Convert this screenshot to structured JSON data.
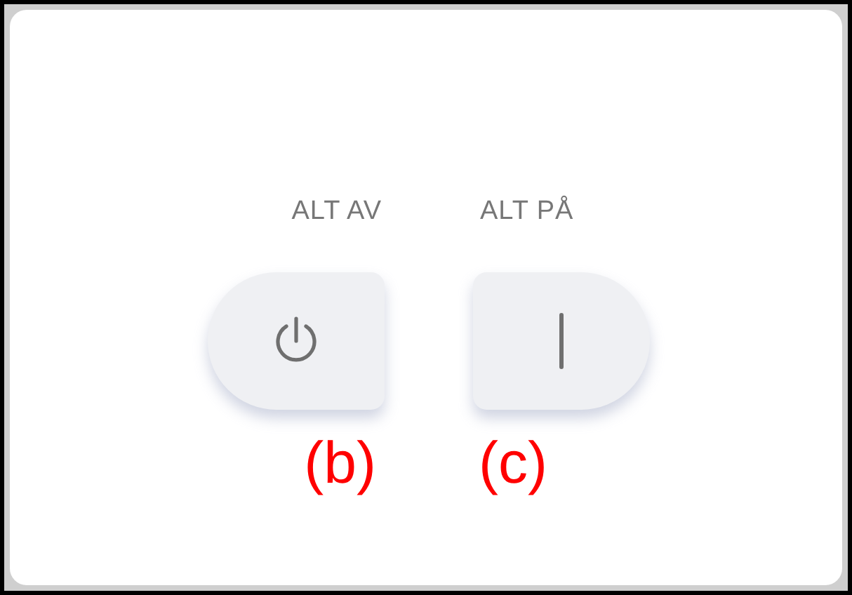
{
  "switches": [
    {
      "label": "ALT AV",
      "kind": "off",
      "annotation": "(b)"
    },
    {
      "label": "ALT PÅ",
      "kind": "on",
      "annotation": "(c)"
    }
  ]
}
